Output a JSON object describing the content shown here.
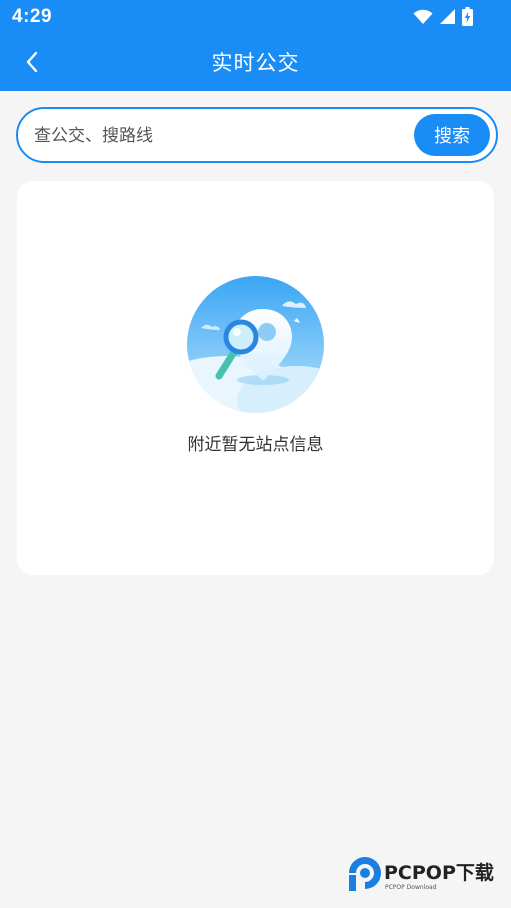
{
  "status_bar": {
    "time": "4:29",
    "icons": [
      "wifi-icon",
      "cell-signal-icon",
      "battery-charging-icon"
    ]
  },
  "app_bar": {
    "title": "实时公交",
    "back_icon": "chevron-left-icon"
  },
  "search": {
    "placeholder": "查公交、搜路线",
    "value": "",
    "button_label": "搜索"
  },
  "empty_state": {
    "message": "附近暂无站点信息",
    "illustration": "map-pin-search-illustration"
  },
  "watermark": {
    "brand": "PCPOP下载",
    "sub": "PCPOP Download"
  },
  "colors": {
    "primary": "#1a8cf5",
    "background": "#f5f5f5",
    "card": "#ffffff",
    "text": "#333333"
  }
}
